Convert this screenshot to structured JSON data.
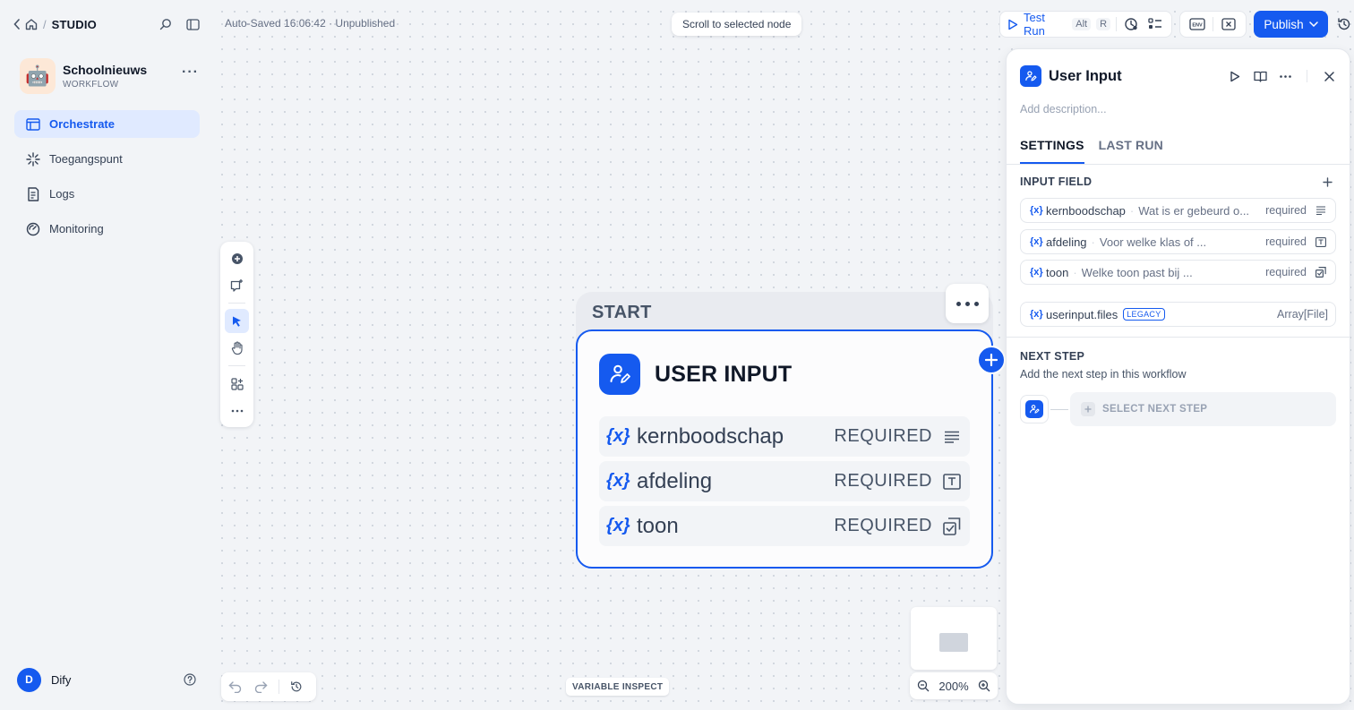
{
  "breadcrumb": {
    "section": "STUDIO"
  },
  "app": {
    "name": "Schoolnieuws",
    "type": "WORKFLOW",
    "avatar": "🤖"
  },
  "nav": [
    {
      "label": "Orchestrate",
      "icon": "layout-icon",
      "active": true
    },
    {
      "label": "Toegangspunt",
      "icon": "endpoint-icon",
      "active": false
    },
    {
      "label": "Logs",
      "icon": "logs-icon",
      "active": false
    },
    {
      "label": "Monitoring",
      "icon": "monitoring-icon",
      "active": false
    }
  ],
  "user": {
    "initial": "D",
    "name": "Dify"
  },
  "canvas": {
    "autosave": "Auto-Saved 16:06:42 · Unpublished",
    "scroll_button": "Scroll to selected node",
    "zoom": "200%",
    "variable_inspect": "VARIABLE INSPECT"
  },
  "toolbar": {
    "test_run": "Test Run",
    "shortcut_alt": "Alt",
    "shortcut_key": "R",
    "publish": "Publish"
  },
  "node": {
    "group_label": "START",
    "title": "USER INPUT",
    "var_symbol": "{x}",
    "fields": [
      {
        "name": "kernboodschap",
        "required": "REQUIRED",
        "type_icon": "paragraph-icon"
      },
      {
        "name": "afdeling",
        "required": "REQUIRED",
        "type_icon": "text-input-icon"
      },
      {
        "name": "toon",
        "required": "REQUIRED",
        "type_icon": "select-icon"
      }
    ]
  },
  "panel": {
    "title": "User Input",
    "description_placeholder": "Add description...",
    "tabs": [
      "SETTINGS",
      "LAST RUN"
    ],
    "input_field_title": "INPUT FIELD",
    "var_symbol": "{x}",
    "fields": [
      {
        "name": "kernboodschap",
        "label": "Wat is er gebeurd o...",
        "required": "required"
      },
      {
        "name": "afdeling",
        "label": "Voor welke klas of ...",
        "required": "required"
      },
      {
        "name": "toon",
        "label": "Welke toon past bij ...",
        "required": "required"
      }
    ],
    "system_field": {
      "name": "userinput.files",
      "badge": "LEGACY",
      "type": "Array[File]"
    },
    "next_step_title": "NEXT STEP",
    "next_step_subtitle": "Add the next step in this workflow",
    "select_next_step": "SELECT NEXT STEP"
  },
  "colors": {
    "accent": "#155aef",
    "canvas_bg": "#f2f4f7",
    "active_nav_bg": "#e0eaff"
  }
}
